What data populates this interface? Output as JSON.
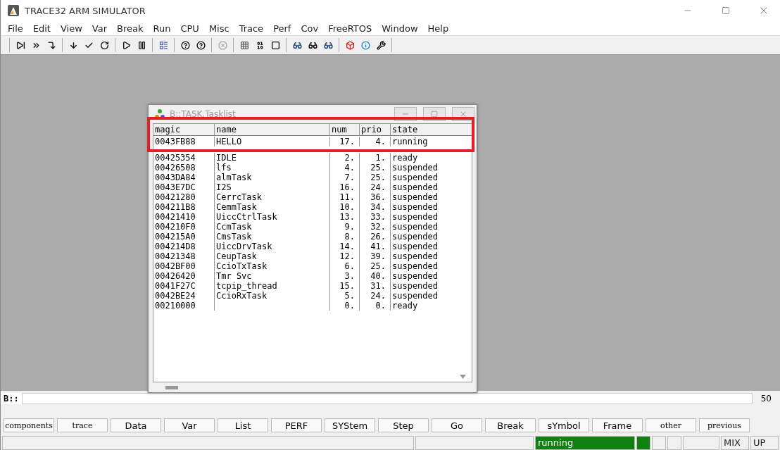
{
  "window": {
    "title": "TRACE32 ARM SIMULATOR"
  },
  "menu": [
    "File",
    "Edit",
    "View",
    "Var",
    "Break",
    "Run",
    "CPU",
    "Misc",
    "Trace",
    "Perf",
    "Cov",
    "FreeRTOS",
    "Window",
    "Help"
  ],
  "tasklist": {
    "title": "B::TASK.Tasklist",
    "highlighted": true,
    "columns": [
      "magic",
      "name",
      "num",
      "prio",
      "state"
    ],
    "rows": [
      [
        "0043FB88",
        "HELLO",
        "17.",
        "4.",
        "running"
      ],
      [
        "00425354",
        "IDLE",
        "2.",
        "1.",
        "ready"
      ],
      [
        "00426508",
        "lfs",
        "4.",
        "25.",
        "suspended"
      ],
      [
        "0043DA84",
        "almTask",
        "7.",
        "25.",
        "suspended"
      ],
      [
        "0043E7DC",
        "I2S",
        "16.",
        "24.",
        "suspended"
      ],
      [
        "00421280",
        "CerrcTask",
        "11.",
        "36.",
        "suspended"
      ],
      [
        "004211B8",
        "CemmTask",
        "10.",
        "34.",
        "suspended"
      ],
      [
        "00421410",
        "UiccCtrlTask",
        "13.",
        "33.",
        "suspended"
      ],
      [
        "004210F0",
        "CcmTask",
        "9.",
        "32.",
        "suspended"
      ],
      [
        "004215A0",
        "CmsTask",
        "8.",
        "26.",
        "suspended"
      ],
      [
        "004214D8",
        "UiccDrvTask",
        "14.",
        "41.",
        "suspended"
      ],
      [
        "00421348",
        "CeupTask",
        "12.",
        "39.",
        "suspended"
      ],
      [
        "0042BF00",
        "CcioTxTask",
        "6.",
        "25.",
        "suspended"
      ],
      [
        "00426420",
        "Tmr Svc",
        "3.",
        "40.",
        "suspended"
      ],
      [
        "0041F27C",
        "tcpip_thread",
        "15.",
        "31.",
        "suspended"
      ],
      [
        "0042BE24",
        "CcioRxTask",
        "5.",
        "24.",
        "suspended"
      ],
      [
        "00210000",
        "",
        "0.",
        "0.",
        "ready"
      ]
    ]
  },
  "command": {
    "prompt": "B::",
    "counter": "50"
  },
  "buttons": [
    {
      "label": "components",
      "kind": "small"
    },
    {
      "label": "trace",
      "kind": "small"
    },
    {
      "label": "Data",
      "kind": "plain"
    },
    {
      "label": "Var",
      "kind": "plain"
    },
    {
      "label": "List",
      "kind": "plain"
    },
    {
      "label": "PERF",
      "kind": "plain"
    },
    {
      "label": "SYStem",
      "kind": "plain"
    },
    {
      "label": "Step",
      "kind": "plain"
    },
    {
      "label": "Go",
      "kind": "plain"
    },
    {
      "label": "Break",
      "kind": "plain"
    },
    {
      "label": "sYmbol",
      "kind": "plain"
    },
    {
      "label": "Frame",
      "kind": "plain"
    },
    {
      "label": "other",
      "kind": "small"
    },
    {
      "label": "previous",
      "kind": "small"
    }
  ],
  "status_bar": {
    "state": "running",
    "mode": "MIX",
    "direction": "UP"
  }
}
